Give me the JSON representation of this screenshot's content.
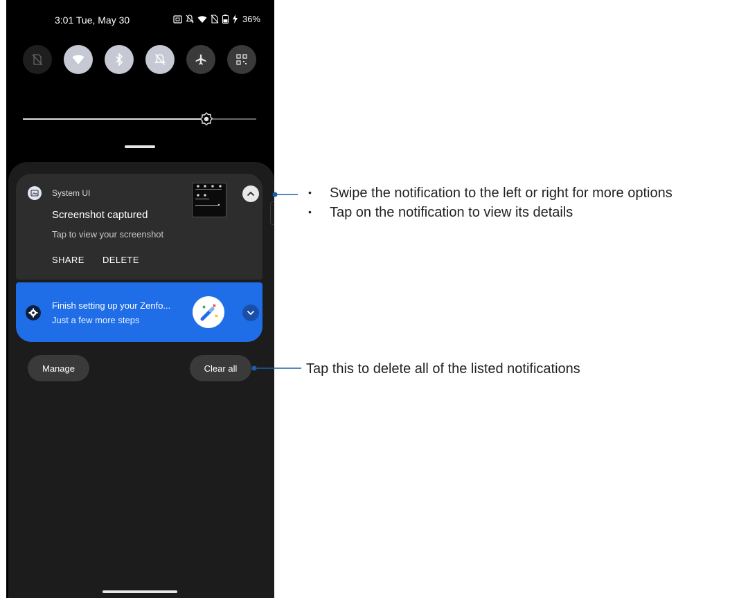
{
  "status_bar": {
    "time": "3:01",
    "date": "Tue, May 30",
    "battery": "36%",
    "icons": [
      "nfc-icon",
      "mute-icon",
      "wifi-icon",
      "no-sim-icon",
      "battery-icon",
      "charging-icon"
    ]
  },
  "quick_tiles": [
    {
      "name": "data-off-icon",
      "state": "off"
    },
    {
      "name": "wifi-icon",
      "state": "on"
    },
    {
      "name": "bluetooth-icon",
      "state": "on"
    },
    {
      "name": "mute-icon",
      "state": "on"
    },
    {
      "name": "airplane-icon",
      "state": "dim"
    },
    {
      "name": "qr-code-icon",
      "state": "dim"
    }
  ],
  "brightness": {
    "level": 0.77
  },
  "notifications": [
    {
      "app": "System UI",
      "title": "Screenshot captured",
      "subtitle": "Tap to view your screenshot",
      "actions": [
        "SHARE",
        "DELETE"
      ]
    },
    {
      "title": "Finish setting up your Zenfo...",
      "subtitle": "Just a few more steps"
    }
  ],
  "buttons": {
    "manage": "Manage",
    "clear_all": "Clear all"
  },
  "annotations": {
    "swipe": "Swipe the notification to the left or right for more options",
    "tap_details": "Tap on the notification to view its details",
    "clear_all": "Tap this to delete all of the listed notifications",
    "bullet": "•"
  },
  "colors": {
    "blue_card": "#1f6ee8",
    "callout_line": "#1a5fa8",
    "shade": "#1c1c1c"
  }
}
